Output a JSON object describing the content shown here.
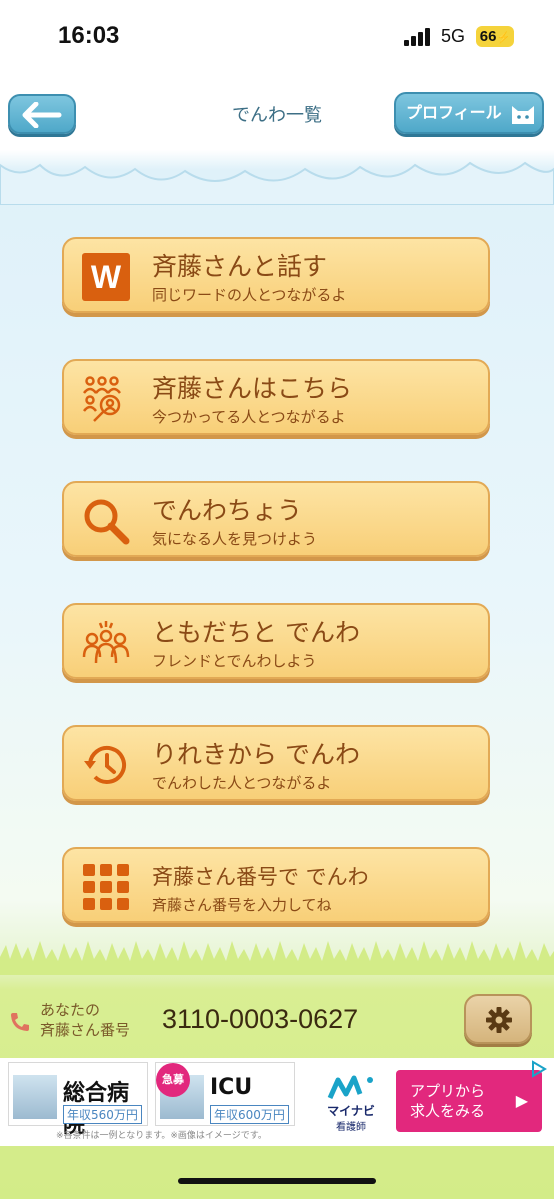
{
  "status_bar": {
    "time": "16:03",
    "network": "5G",
    "battery": "66"
  },
  "header": {
    "title": "でんわ一覧",
    "profile_label": "プロフィール"
  },
  "menu": [
    {
      "title": "斉藤さんと話す",
      "subtitle": "同じワードの人とつながるよ",
      "icon": "w-icon",
      "icon_text": "W"
    },
    {
      "title": "斉藤さんはこちら",
      "subtitle": "今つかってる人とつながるよ",
      "icon": "people-search-icon"
    },
    {
      "title": "でんわちょう",
      "subtitle": "気になる人を見つけよう",
      "icon": "magnifier-icon"
    },
    {
      "title": "ともだちと でんわ",
      "subtitle": "フレンドとでんわしよう",
      "icon": "friends-icon"
    },
    {
      "title": "りれきから でんわ",
      "subtitle": "でんわした人とつながるよ",
      "icon": "history-icon"
    },
    {
      "title": "斉藤さん番号で でんわ",
      "subtitle": "斉藤さん番号を入力してね",
      "icon": "keypad-icon"
    }
  ],
  "footer": {
    "label_line1": "あなたの",
    "label_line2": "斉藤さん番号",
    "number": "3110-0003-0627"
  },
  "ad": {
    "card1_title": "総合病院",
    "card1_salary": "年収560万円",
    "card2_badge": "急募",
    "card2_title": "ICU",
    "card2_salary": "年収600万円",
    "note": "※各条件は一例となります。※画像はイメージです。",
    "brand_name": "マイナビ",
    "brand_sub": "看護師",
    "cta_line1": "アプリから",
    "cta_line2": "求人をみる",
    "cta_arrow": "▶"
  },
  "colors": {
    "accent": "#d9600f",
    "button_bg": "#f8cf78",
    "text_brown": "#8a4a16",
    "header_blue": "#4fa8c9",
    "ad_pink": "#e2287d"
  }
}
